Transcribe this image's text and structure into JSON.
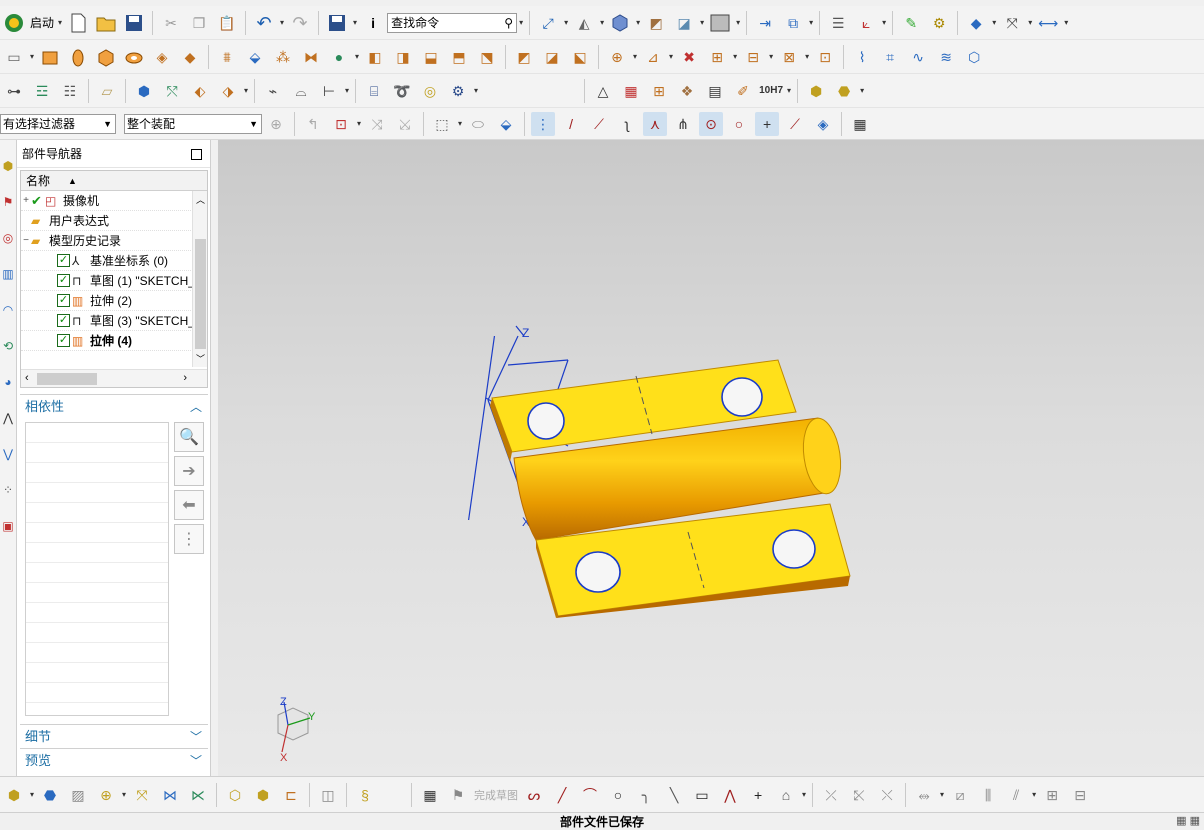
{
  "toolbar": {
    "start_label": "启动",
    "command_search_value": "查找命令"
  },
  "selection_bar": {
    "filter_value": "有选择过滤器",
    "scope_value": "整个装配"
  },
  "navigator": {
    "title": "部件导航器",
    "column_name": "名称",
    "nodes": [
      {
        "label": "摄像机",
        "expand": "+"
      },
      {
        "label": "用户表达式",
        "expand": ""
      },
      {
        "label": "模型历史记录",
        "expand": "−"
      },
      {
        "label": "基准坐标系 (0)",
        "expand": ""
      },
      {
        "label": "草图 (1) \"SKETCH_",
        "expand": ""
      },
      {
        "label": "拉伸 (2)",
        "expand": ""
      },
      {
        "label": "草图 (3) \"SKETCH_",
        "expand": ""
      },
      {
        "label": "拉伸 (4)",
        "expand": ""
      }
    ],
    "sections": {
      "dependencies": "相依性",
      "details": "细节",
      "preview": "预览"
    }
  },
  "sketch_bar": {
    "finish_sketch_label": "完成草图"
  },
  "graphics": {
    "datum_axes": {
      "z": "Z",
      "x": "X"
    },
    "triad": {
      "z": "Z",
      "y": "Y",
      "x": "X"
    },
    "part_color": "#f7c411",
    "background_top": "#c9c9c9",
    "background_bottom": "#e9e9e9"
  },
  "status": {
    "message": "部件文件已保存"
  }
}
